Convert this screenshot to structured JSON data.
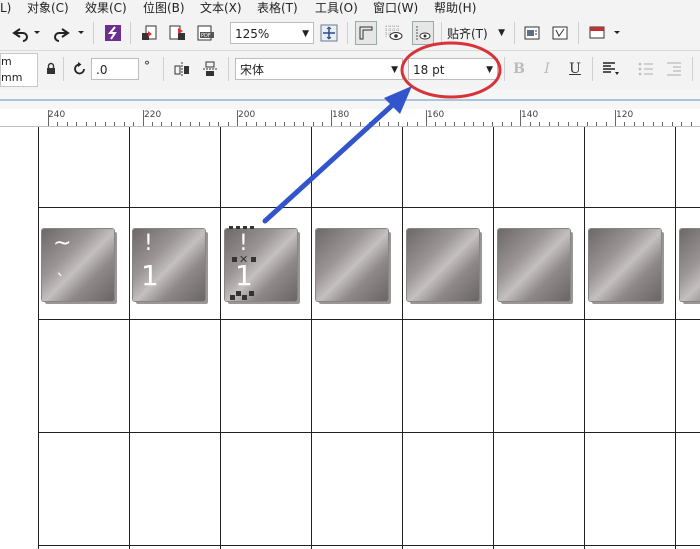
{
  "menu": {
    "items": [
      {
        "label": "L)"
      },
      {
        "label": "对象(C)"
      },
      {
        "label": "效果(C)"
      },
      {
        "label": "位图(B)"
      },
      {
        "label": "文本(X)"
      },
      {
        "label": "表格(T)"
      },
      {
        "label": "工具(O)"
      },
      {
        "label": "窗口(W)"
      },
      {
        "label": "帮助(H)"
      }
    ]
  },
  "toolbar1": {
    "zoom_value": "125%",
    "snap_label": "贴齐(T)"
  },
  "toolbar2": {
    "unit_line1": "m",
    "unit_line2": "mm",
    "rotation_value": ".0",
    "degree_symbol": "°",
    "font_name": "宋体",
    "font_size": "18 pt"
  },
  "ruler": {
    "labels": [
      "240",
      "220",
      "200",
      "180",
      "160",
      "140",
      "120"
    ]
  },
  "canvas": {
    "tiles": [
      {
        "glyph_top": "~",
        "glyph_bottom": "`"
      },
      {
        "glyph_top": "!",
        "glyph_bottom": "1"
      },
      {
        "glyph_top": "!",
        "glyph_bottom": "1"
      },
      {
        "glyph_top": "",
        "glyph_bottom": ""
      },
      {
        "glyph_top": "",
        "glyph_bottom": ""
      },
      {
        "glyph_top": "",
        "glyph_bottom": ""
      },
      {
        "glyph_top": "",
        "glyph_bottom": ""
      }
    ]
  },
  "annotation": {
    "arrow_color": "#3355cc",
    "highlight_color": "#d9333a"
  }
}
